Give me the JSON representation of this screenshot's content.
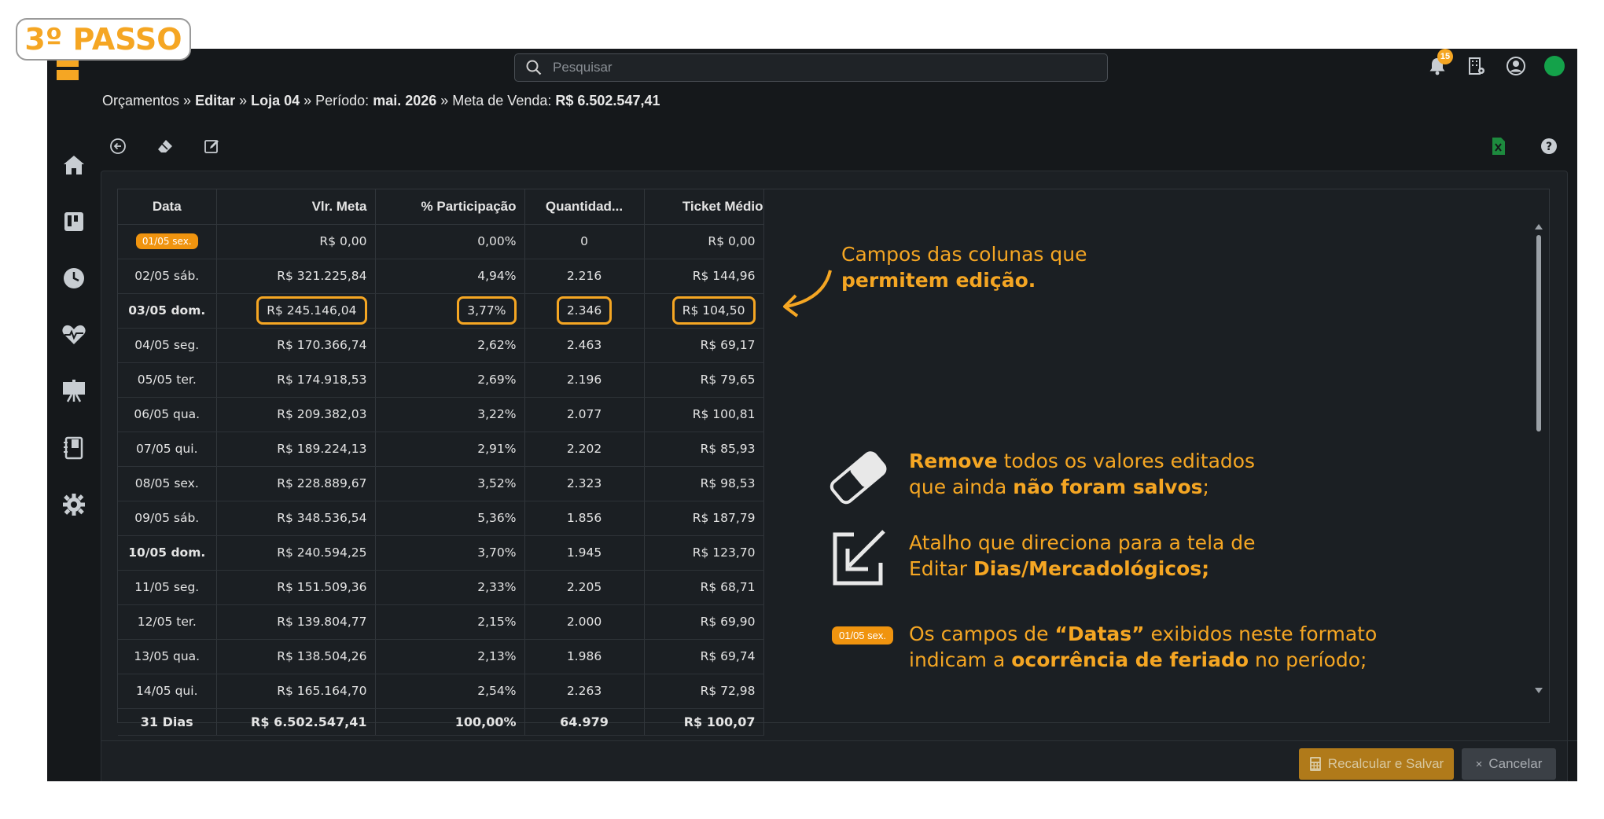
{
  "step_badge": "3º PASSO",
  "search": {
    "placeholder": "Pesquisar"
  },
  "notifications": {
    "count": "15"
  },
  "breadcrumb": {
    "part1": "Orçamentos",
    "sep": " » ",
    "part2": "Editar",
    "part3": "Loja 04",
    "periodo_label": "Período: ",
    "periodo_value": "mai. 2026",
    "meta_label": "Meta de Venda: ",
    "meta_value": "R$ 6.502.547,41"
  },
  "table": {
    "headers": [
      "Data",
      "Vlr. Meta",
      "% Participação",
      "Quantidad...",
      "Ticket Médio"
    ],
    "rows": [
      {
        "date": "01/05 sex.",
        "meta": "R$ 0,00",
        "part": "0,00%",
        "qty": "0",
        "ticket": "R$ 0,00"
      },
      {
        "date": "02/05 sáb.",
        "meta": "R$ 321.225,84",
        "part": "4,94%",
        "qty": "2.216",
        "ticket": "R$ 144,96"
      },
      {
        "date": "03/05 dom.",
        "meta": "R$ 245.146,04",
        "part": "3,77%",
        "qty": "2.346",
        "ticket": "R$ 104,50"
      },
      {
        "date": "04/05 seg.",
        "meta": "R$ 170.366,74",
        "part": "2,62%",
        "qty": "2.463",
        "ticket": "R$ 69,17"
      },
      {
        "date": "05/05 ter.",
        "meta": "R$ 174.918,53",
        "part": "2,69%",
        "qty": "2.196",
        "ticket": "R$ 79,65"
      },
      {
        "date": "06/05 qua.",
        "meta": "R$ 209.382,03",
        "part": "3,22%",
        "qty": "2.077",
        "ticket": "R$ 100,81"
      },
      {
        "date": "07/05 qui.",
        "meta": "R$ 189.224,13",
        "part": "2,91%",
        "qty": "2.202",
        "ticket": "R$ 85,93"
      },
      {
        "date": "08/05 sex.",
        "meta": "R$ 228.889,67",
        "part": "3,52%",
        "qty": "2.323",
        "ticket": "R$ 98,53"
      },
      {
        "date": "09/05 sáb.",
        "meta": "R$ 348.536,54",
        "part": "5,36%",
        "qty": "1.856",
        "ticket": "R$ 187,79"
      },
      {
        "date": "10/05 dom.",
        "meta": "R$ 240.594,25",
        "part": "3,70%",
        "qty": "1.945",
        "ticket": "R$ 123,70"
      },
      {
        "date": "11/05 seg.",
        "meta": "R$ 151.509,36",
        "part": "2,33%",
        "qty": "2.205",
        "ticket": "R$ 68,71"
      },
      {
        "date": "12/05 ter.",
        "meta": "R$ 139.804,77",
        "part": "2,15%",
        "qty": "2.000",
        "ticket": "R$ 69,90"
      },
      {
        "date": "13/05 qua.",
        "meta": "R$ 138.504,26",
        "part": "2,13%",
        "qty": "1.986",
        "ticket": "R$ 69,74"
      },
      {
        "date": "14/05 qui.",
        "meta": "R$ 165.164,70",
        "part": "2,54%",
        "qty": "2.263",
        "ticket": "R$ 72,98"
      }
    ],
    "total": {
      "date": "31 Dias",
      "meta": "R$ 6.502.547,41",
      "part": "100,00%",
      "qty": "64.979",
      "ticket": "R$ 100,07"
    }
  },
  "annotations": {
    "edit_fields": {
      "line1": "Campos das colunas que",
      "line2": "permitem edição."
    },
    "remove": {
      "bold1": "Remove",
      "text1": " todos os valores editados",
      "text2": "que ainda ",
      "bold2": "não foram salvos",
      "text3": ";"
    },
    "shortcut": {
      "line1": "Atalho que direciona para a tela de",
      "text2": "Editar ",
      "bold2": "Dias/Mercadológicos;"
    },
    "holiday": {
      "badge": "01/05 sex.",
      "text1": "Os campos de ",
      "bold1": "“Datas”",
      "text2": " exibidos neste formato",
      "text3": "indicam a ",
      "bold2": "ocorrência de feriado",
      "text4": " no período;"
    }
  },
  "footer": {
    "save_label": "Recalcular e Salvar",
    "cancel_label": "Cancelar"
  },
  "colors": {
    "accent": "#f5a623",
    "background": "#15181b",
    "panel": "#1c2024",
    "status_online": "#14a24a"
  }
}
